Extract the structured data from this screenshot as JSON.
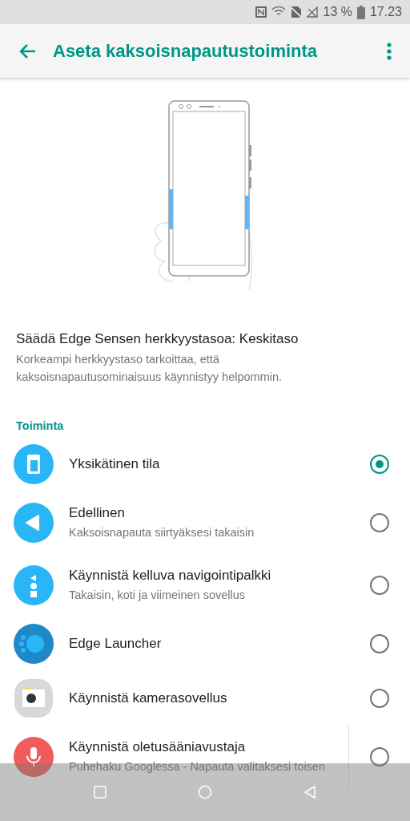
{
  "status_bar": {
    "battery": "13 %",
    "time": "17.23"
  },
  "toolbar": {
    "title": "Aseta kaksoisnapautustoiminta"
  },
  "sensitivity": {
    "title": "Säädä Edge Sensen herkkyystasoa: Keskitaso",
    "description": "Korkeampi herkkyystaso tarkoittaa, että kaksoisnapautusominaisuus käynnistyy helpommin."
  },
  "section": {
    "title": "Toiminta"
  },
  "actions": [
    {
      "kind": "phone",
      "title": "Yksikätinen tila",
      "selected": true
    },
    {
      "kind": "back",
      "title": "Edellinen",
      "subtitle": "Kaksoisnapauta siirtyäksesi takaisin",
      "selected": false
    },
    {
      "kind": "navbar",
      "title": "Käynnistä kelluva navigointipalkki",
      "subtitle": "Takaisin, koti ja viimeinen sovellus",
      "selected": false
    },
    {
      "kind": "launcher",
      "title": "Edge Launcher",
      "selected": false
    },
    {
      "kind": "camera",
      "title": "Käynnistä kamerasovellus",
      "selected": false
    },
    {
      "kind": "mic",
      "title": "Käynnistä oletusääniavustaja",
      "subtitle": "Puhehaku Googlessa - Napauta valitaksesi toisen",
      "selected": false,
      "divider": true
    }
  ]
}
